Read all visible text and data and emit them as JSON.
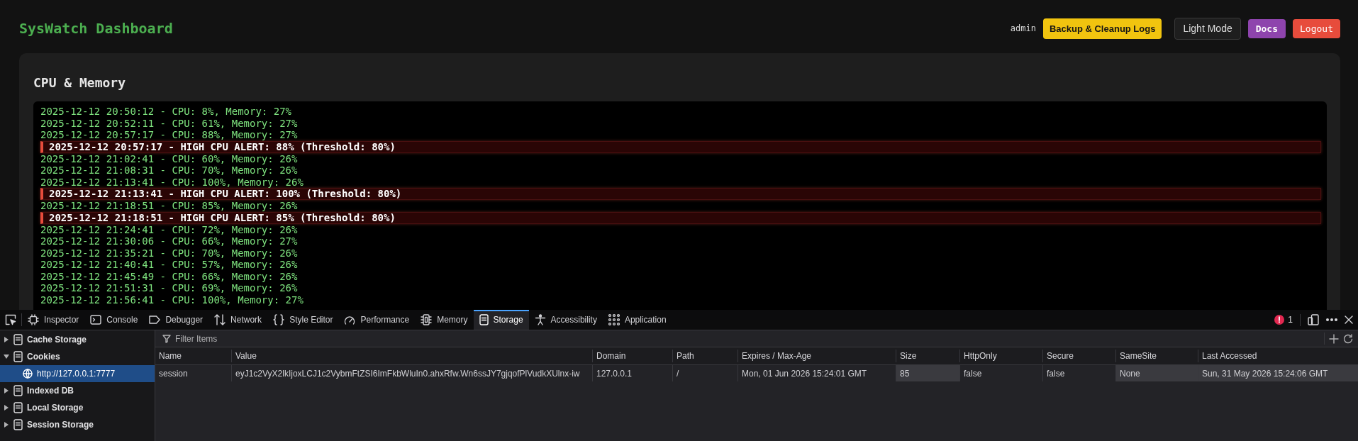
{
  "header": {
    "title": "SysWatch Dashboard",
    "user": "admin",
    "buttons": [
      {
        "label": "Backup & Cleanup Logs",
        "kind": "warning"
      },
      {
        "label": "Light Mode",
        "kind": "outline"
      },
      {
        "label": "Docs",
        "kind": "docs"
      },
      {
        "label": "Logout",
        "kind": "danger"
      }
    ]
  },
  "card": {
    "title": "CPU & Memory",
    "log": [
      {
        "kind": "normal",
        "text": "2025-12-12 20:50:12 - CPU: 8%, Memory: 27%"
      },
      {
        "kind": "normal",
        "text": "2025-12-12 20:52:11 - CPU: 61%, Memory: 27%"
      },
      {
        "kind": "normal",
        "text": "2025-12-12 20:57:17 - CPU: 88%, Memory: 27%"
      },
      {
        "kind": "alert",
        "text": "2025-12-12 20:57:17 - HIGH CPU ALERT: 88% (Threshold: 80%)"
      },
      {
        "kind": "normal",
        "text": "2025-12-12 21:02:41 - CPU: 60%, Memory: 26%"
      },
      {
        "kind": "normal",
        "text": "2025-12-12 21:08:31 - CPU: 70%, Memory: 26%"
      },
      {
        "kind": "normal",
        "text": "2025-12-12 21:13:41 - CPU: 100%, Memory: 26%"
      },
      {
        "kind": "alert",
        "text": "2025-12-12 21:13:41 - HIGH CPU ALERT: 100% (Threshold: 80%)"
      },
      {
        "kind": "normal",
        "text": "2025-12-12 21:18:51 - CPU: 85%, Memory: 26%"
      },
      {
        "kind": "alert",
        "text": "2025-12-12 21:18:51 - HIGH CPU ALERT: 85% (Threshold: 80%)"
      },
      {
        "kind": "normal",
        "text": "2025-12-12 21:24:41 - CPU: 72%, Memory: 26%"
      },
      {
        "kind": "normal",
        "text": "2025-12-12 21:30:06 - CPU: 66%, Memory: 27%"
      },
      {
        "kind": "normal",
        "text": "2025-12-12 21:35:21 - CPU: 70%, Memory: 26%"
      },
      {
        "kind": "normal",
        "text": "2025-12-12 21:40:41 - CPU: 57%, Memory: 26%"
      },
      {
        "kind": "normal",
        "text": "2025-12-12 21:45:49 - CPU: 66%, Memory: 26%"
      },
      {
        "kind": "normal",
        "text": "2025-12-12 21:51:31 - CPU: 69%, Memory: 26%"
      },
      {
        "kind": "normal",
        "text": "2025-12-12 21:56:41 - CPU: 100%, Memory: 27%"
      }
    ]
  },
  "devtools": {
    "tabs": [
      {
        "label": "Inspector",
        "selected": false
      },
      {
        "label": "Console",
        "selected": false
      },
      {
        "label": "Debugger",
        "selected": false
      },
      {
        "label": "Network",
        "selected": false
      },
      {
        "label": "Style Editor",
        "selected": false
      },
      {
        "label": "Performance",
        "selected": false
      },
      {
        "label": "Memory",
        "selected": false
      },
      {
        "label": "Storage",
        "selected": true
      },
      {
        "label": "Accessibility",
        "selected": false
      },
      {
        "label": "Application",
        "selected": false
      }
    ],
    "error_count": "1",
    "sidebar": [
      {
        "label": "Cache Storage",
        "expanded": false,
        "selected": false
      },
      {
        "label": "Cookies",
        "expanded": true,
        "selected": false,
        "children": [
          {
            "label": "http://127.0.0.1:7777",
            "selected": true
          }
        ]
      },
      {
        "label": "Indexed DB",
        "expanded": false,
        "selected": false
      },
      {
        "label": "Local Storage",
        "expanded": false,
        "selected": false
      },
      {
        "label": "Session Storage",
        "expanded": false,
        "selected": false
      }
    ],
    "filter": {
      "placeholder": "Filter Items"
    },
    "table": {
      "columns": [
        "Name",
        "Value",
        "Domain",
        "Path",
        "Expires / Max-Age",
        "Size",
        "HttpOnly",
        "Secure",
        "SameSite",
        "Last Accessed"
      ],
      "rows": [
        {
          "cells": [
            {
              "text": "session",
              "highlighted": false
            },
            {
              "text": "eyJ1c2VyX2lkIjoxLCJ1c2VybmFtZSI6ImFkbWluIn0.ahxRfw.Wn6ssJY7gjqofPlVudkXUlnx-iw",
              "highlighted": false
            },
            {
              "text": "127.0.0.1",
              "highlighted": false
            },
            {
              "text": "/",
              "highlighted": false
            },
            {
              "text": "Mon, 01 Jun 2026 15:24:01 GMT",
              "highlighted": false
            },
            {
              "text": "85",
              "highlighted": true
            },
            {
              "text": "false",
              "highlighted": false
            },
            {
              "text": "false",
              "highlighted": false
            },
            {
              "text": "None",
              "highlighted": true
            },
            {
              "text": "Sun, 31 May 2026 15:24:06 GMT",
              "highlighted": true
            }
          ]
        }
      ]
    }
  }
}
